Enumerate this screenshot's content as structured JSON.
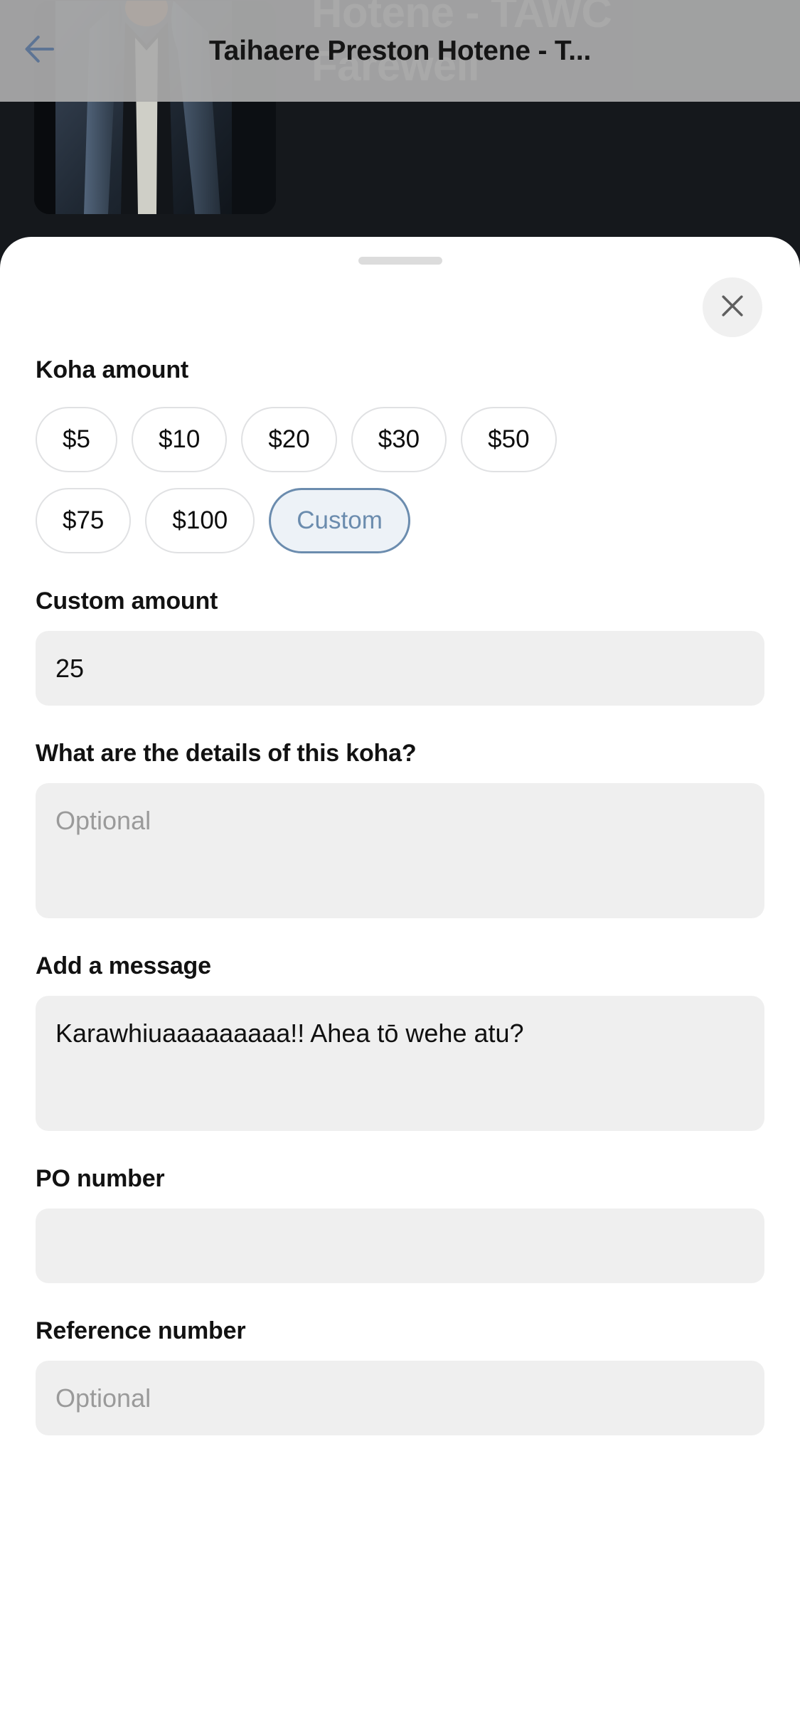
{
  "appbar": {
    "title": "Taihaere Preston Hotene - T...",
    "back_icon": "arrow-left-icon"
  },
  "backdrop": {
    "event_title": "Hotene - TAWC Farewell",
    "thumbnail_alt": "person-in-puffer-jacket-photo"
  },
  "sheet": {
    "close_icon": "close-icon",
    "grabber": "drag-handle"
  },
  "koha": {
    "label": "Koha amount",
    "chips_row1": [
      "$5",
      "$10",
      "$20",
      "$30",
      "$50"
    ],
    "chips_row2": [
      "$75",
      "$100",
      "Custom"
    ],
    "selected_chip": "Custom",
    "selected_border_color": "#6b8cae",
    "selected_fill_color": "#edf2f7",
    "selected_text_color": "#6b8cae"
  },
  "custom_amount": {
    "label": "Custom amount",
    "value": "25",
    "placeholder": ""
  },
  "details": {
    "label": "What are the details of this koha?",
    "value": "",
    "placeholder": "Optional"
  },
  "message": {
    "label": "Add a message",
    "value": "Karawhiuaaaaaaaaa!! Ahea tō wehe atu?",
    "placeholder": ""
  },
  "po_number": {
    "label": "PO number",
    "value": "",
    "placeholder": ""
  },
  "reference_number": {
    "label": "Reference number",
    "value": "",
    "placeholder": "Optional"
  }
}
